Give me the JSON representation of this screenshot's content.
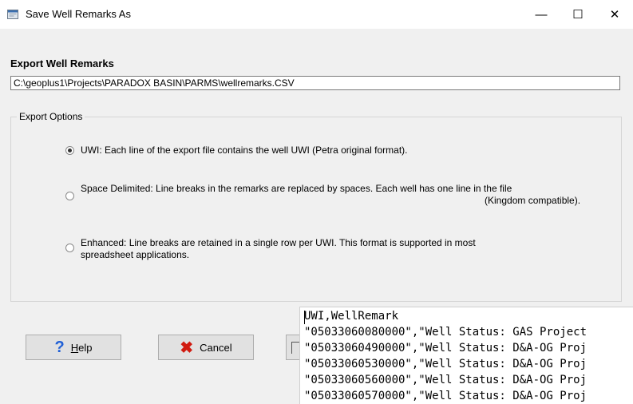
{
  "window": {
    "title": "Save Well Remarks As",
    "minimize_glyph": "—",
    "maximize_glyph": "☐",
    "close_glyph": "✕"
  },
  "export": {
    "label": "Export Well Remarks",
    "path": "C:\\geoplus1\\Projects\\PARADOX BASIN\\PARMS\\wellremarks.CSV"
  },
  "options": {
    "title": "Export Options",
    "uwi": {
      "text": "UWI: Each line of the export file contains the well UWI (Petra original format).",
      "checked": true
    },
    "space": {
      "line1": "Space Delimited: Line breaks in the remarks are replaced by spaces. Each well has one line in the file",
      "line2": "(Kingdom compatible).",
      "checked": false
    },
    "enhanced": {
      "line1": "Enhanced: Line breaks are retained in a single row per UWI. This format is supported in most",
      "line2": "spreadsheet applications.",
      "checked": false
    }
  },
  "buttons": {
    "help_mnemonic": "H",
    "help_rest": "elp",
    "cancel": "Cancel"
  },
  "preview": {
    "lines": [
      "UWI,WellRemark",
      "\"05033060080000\",\"Well Status: GAS Project",
      "\"05033060490000\",\"Well Status: D&A-OG Proj",
      "\"05033060530000\",\"Well Status: D&A-OG Proj",
      "\"05033060560000\",\"Well Status: D&A-OG Proj",
      "\"05033060570000\",\"Well Status: D&A-OG Proj"
    ]
  },
  "icons": {
    "app": "dialog-window-icon",
    "help": "question-icon",
    "cancel": "x-icon"
  },
  "colors": {
    "help_icon": "#1f5fd6",
    "cancel_icon": "#d11b10"
  }
}
